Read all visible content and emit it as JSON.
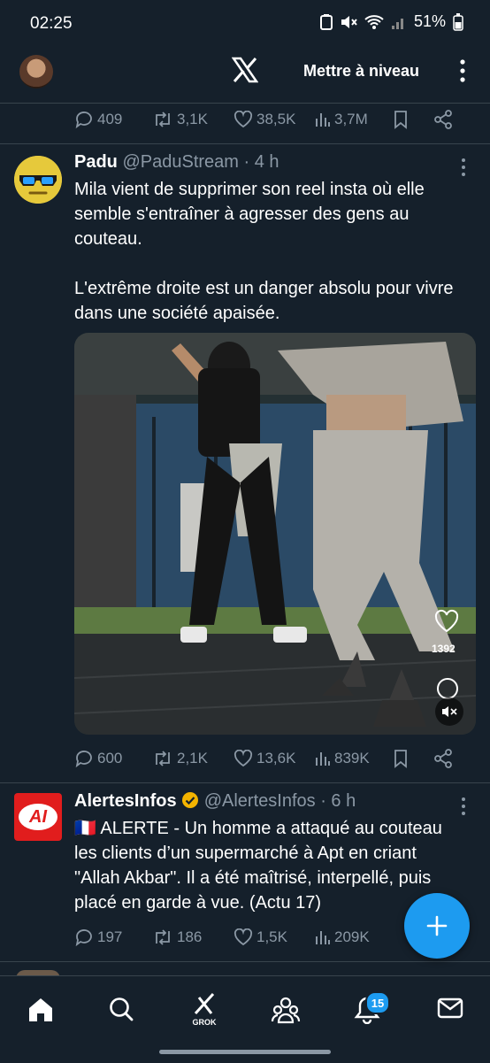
{
  "status_bar": {
    "time": "02:25",
    "battery": "51%"
  },
  "header": {
    "upgrade_label": "Mettre à niveau"
  },
  "prev_tweet": {
    "replies": "409",
    "reposts": "3,1K",
    "likes": "38,5K",
    "views": "3,7M"
  },
  "tweet1": {
    "name": "Padu",
    "handle": "@PaduStream",
    "time": " · 4 h",
    "text": "Mila vient de supprimer son reel insta où elle semble s'entraîner à agresser des gens au couteau.\n\nL'extrême droite est un danger absolu pour vivre dans une société apaisée.",
    "video_likes": "1392",
    "replies": "600",
    "reposts": "2,1K",
    "likes": "13,6K",
    "views": "839K"
  },
  "tweet2": {
    "name": "AlertesInfos",
    "handle": "@AlertesInfos",
    "time": " · 6 h",
    "avatar_text": "AI",
    "text": "🇫🇷 ALERTE - Un homme a attaqué au couteau les clients d’un supermarché à Apt en criant \"Allah Akbar\". Il a été maîtrisé, interpellé, puis placé en garde à vue. (Actu 17)",
    "replies": "197",
    "reposts": "186",
    "likes": "1,5K",
    "views": "209K"
  },
  "bottom_nav": {
    "grok_label": "GROK",
    "notifications_count": "15"
  },
  "colors": {
    "background": "#15202b",
    "accent": "#1d9bf0",
    "muted": "#8b98a5",
    "divider": "#38444d",
    "verified": "#f4b400"
  }
}
